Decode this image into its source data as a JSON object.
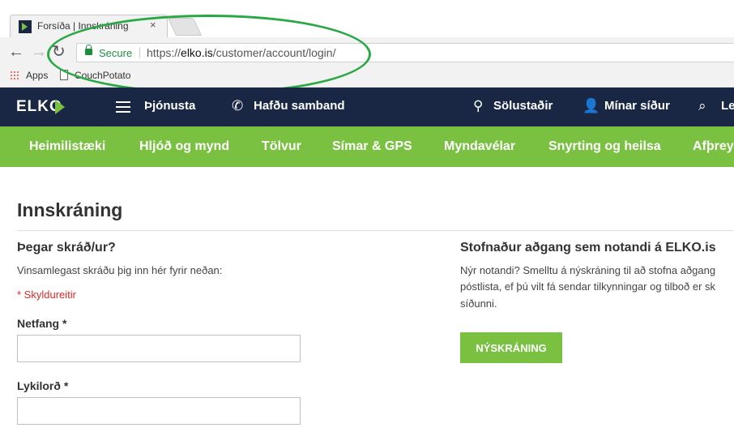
{
  "browser": {
    "tab_title": "Forsíða | Innskráning",
    "tab_close": "×",
    "secure_label": "Secure",
    "url_scheme": "https://",
    "url_host": "elko.is",
    "url_path": "/customer/account/login/",
    "bookmarks": [
      {
        "label": "Apps"
      },
      {
        "label": "CouchPotato"
      }
    ],
    "nav": {
      "back": "←",
      "forward": "→",
      "reload": "↻"
    }
  },
  "header": {
    "logo": "ELKO",
    "items": [
      {
        "label": "Þjónusta"
      },
      {
        "label": "Hafðu samband"
      },
      {
        "label": "Sölustaðir"
      },
      {
        "label": "Mínar síður"
      },
      {
        "label": "Le"
      }
    ]
  },
  "categories": [
    {
      "label": "Heimilistæki"
    },
    {
      "label": "Hljóð og mynd"
    },
    {
      "label": "Tölvur"
    },
    {
      "label": "Símar & GPS"
    },
    {
      "label": "Myndavélar"
    },
    {
      "label": "Snyrting og heilsa"
    },
    {
      "label": "Afþrey"
    }
  ],
  "login": {
    "page_title": "Innskráning",
    "heading": "Þegar skráð/ur?",
    "intro": "Vinsamlegast skráðu þig inn hér fyrir neðan:",
    "required_note": "* Skyldureitir",
    "email_label": "Netfang *",
    "email_value": "",
    "password_label": "Lykilorð *",
    "password_value": ""
  },
  "register": {
    "heading": "Stofnaður aðgang sem notandi á ELKO.is",
    "line1": "Nýr notandi? Smelltu á nýskráning til að stofna aðgang",
    "line2": "póstlista, ef þú vilt fá sendar tilkynningar og tilboð er sk",
    "line3": "síðunni.",
    "button": "NÝSKRÁNING"
  },
  "colors": {
    "header_bg": "#1a2744",
    "accent_green": "#7ac142",
    "required_red": "#e02b27",
    "annotation_green": "#2aa845"
  }
}
